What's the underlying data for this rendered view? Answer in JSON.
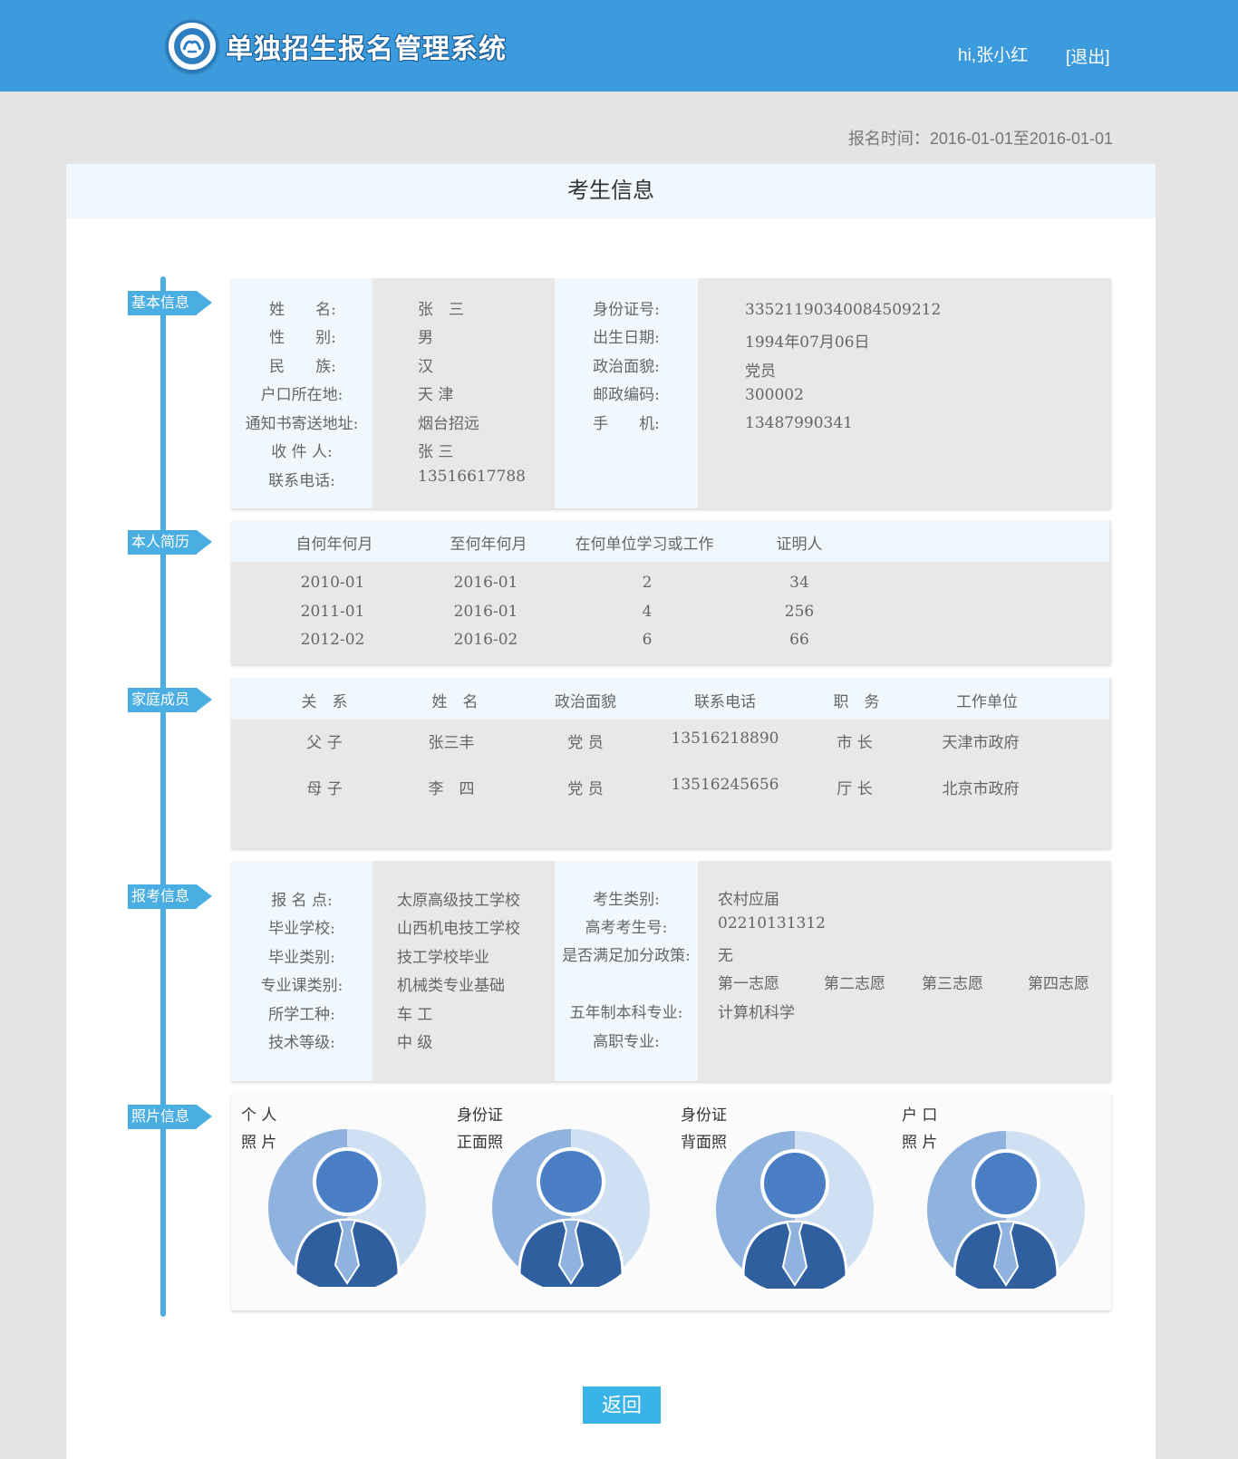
{
  "header": {
    "app_title": "单独招生报名管理系统",
    "greeting": "hi,张小红",
    "logout_label": "[退出]"
  },
  "registration_time": "报名时间：2016-01-01至2016-01-01",
  "page_title": "考生信息",
  "sections": {
    "basic": "基本信息",
    "resume": "本人简历",
    "family": "家庭成员",
    "application": "报考信息",
    "photos": "照片信息"
  },
  "basic_info": {
    "left": [
      {
        "label": "姓　　名:",
        "value": "张　三"
      },
      {
        "label": "性　　别:",
        "value": "男"
      },
      {
        "label": "民　　族:",
        "value": "汉"
      },
      {
        "label": "户口所在地:",
        "value": "天 津"
      },
      {
        "label": "通知书寄送地址:",
        "value": "烟台招远"
      },
      {
        "label": "收 件 人:",
        "value": "张 三"
      },
      {
        "label": "联系电话:",
        "value": "13516617788"
      }
    ],
    "right": [
      {
        "label": "身份证号:",
        "value": "335211903400845092​12"
      },
      {
        "label": "出生日期:",
        "value": "1994年07月06日"
      },
      {
        "label": "政治面貌:",
        "value": "党员"
      },
      {
        "label": "邮政编码:",
        "value": "300002"
      },
      {
        "label": "手　　机:",
        "value": "13487990341"
      }
    ]
  },
  "resume": {
    "headers": [
      "自何年何月",
      "至何年何月",
      "在何单位学习或工作",
      "证明人"
    ],
    "rows": [
      [
        "2010-01",
        "2016-01",
        "2",
        "34"
      ],
      [
        "2011-01",
        "2016-01",
        "4",
        "256"
      ],
      [
        "2012-02",
        "2016-02",
        "6",
        "66"
      ]
    ]
  },
  "family": {
    "headers": [
      "关　系",
      "姓　名",
      "政治面貌",
      "联系电话",
      "职　务",
      "工作单位"
    ],
    "rows": [
      [
        "父 子",
        "张三丰",
        "党 员",
        "13516218890",
        "市 长",
        "天津市政府"
      ],
      [
        "母 子",
        "李　四",
        "党 员",
        "13516245656",
        "厅 长",
        "北京市政府"
      ]
    ]
  },
  "application": {
    "left": [
      {
        "label": "报 名 点:",
        "value": "太原高级技工学校"
      },
      {
        "label": "毕业学校:",
        "value": "山西机电技工学校"
      },
      {
        "label": "毕业类别:",
        "value": "技工学校毕业"
      },
      {
        "label": "专业课类别:",
        "value": "机械类专业基础"
      },
      {
        "label": "所学工种:",
        "value": "车 工"
      },
      {
        "label": "技术等级:",
        "value": "中 级"
      }
    ],
    "right": [
      {
        "label": "考生类别:",
        "value": "农村应届"
      },
      {
        "label": "高考考生号:",
        "value": "02210131312"
      },
      {
        "label": "是否满足加分政策:",
        "value": "无"
      },
      {
        "label": "五年制本科专业:",
        "value": "计算机科学"
      },
      {
        "label": "高职专业:",
        "value": ""
      }
    ],
    "wishes": [
      "第一志愿",
      "第二志愿",
      "第三志愿",
      "第四志愿"
    ]
  },
  "photos": [
    {
      "line1": "个 人",
      "line2": "照 片"
    },
    {
      "line1": "身份证",
      "line2": "正面照"
    },
    {
      "line1": "身份证",
      "line2": "背面照"
    },
    {
      "line1": "户 口",
      "line2": "照 片"
    }
  ],
  "back_label": "返回",
  "colors": {
    "header_bg": "#3b9bdc",
    "accent": "#4aaee2",
    "button": "#3ab3e8"
  }
}
